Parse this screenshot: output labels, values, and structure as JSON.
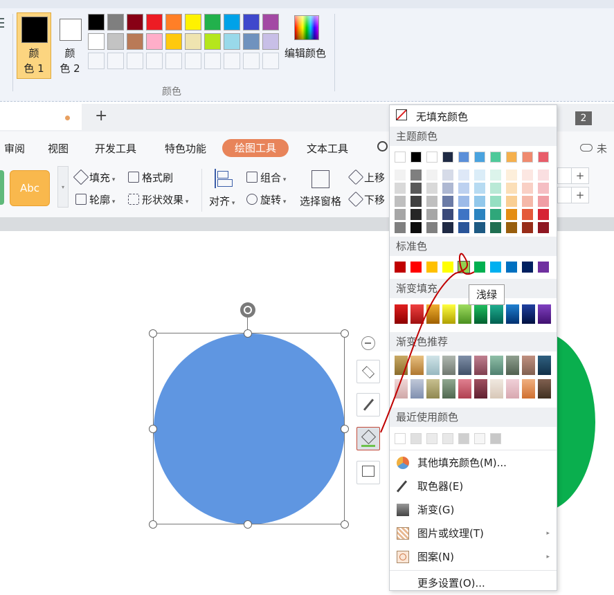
{
  "paint": {
    "color1_label": "颜\n色 1",
    "color2_label": "颜\n色 2",
    "edit_colors_label": "编辑颜色",
    "group_label": "颜色",
    "palette_row1": [
      "#000000",
      "#7f7f7f",
      "#880015",
      "#ed1c24",
      "#ff7f27",
      "#fff200",
      "#22b14c",
      "#00a2e8",
      "#3f48cc",
      "#a349a4"
    ],
    "palette_row2": [
      "#ffffff",
      "#c3c3c3",
      "#b97a57",
      "#ffaec9",
      "#ffc90e",
      "#efe4b0",
      "#b5e61d",
      "#99d9ea",
      "#7092be",
      "#c8bfe7"
    ]
  },
  "tabs": {
    "new_tab_symbol": "+",
    "items": [
      "审阅",
      "视图",
      "开发工具",
      "特色功能",
      "绘图工具",
      "文本工具"
    ],
    "search_icon": "search-icon",
    "right_badge": "2",
    "cloud_label": "未"
  },
  "ribbon": {
    "style_preview": "Abc",
    "fill": "填充",
    "format_painter": "格式刷",
    "outline": "轮廓",
    "shape_effects": "形状效果",
    "align": "对齐",
    "group": "组合",
    "rotate": "旋转",
    "selection_pane": "选择窗格",
    "bring_forward": "上移",
    "send_backward": "下移",
    "spin_plus": "+"
  },
  "menu": {
    "no_fill": "无填充颜色",
    "theme_colors": "主题颜色",
    "standard_colors": "标准色",
    "gradient_fill": "渐变填充",
    "gradient_recommend": "渐变色推荐",
    "recent_colors": "最近使用颜色",
    "more_fill_colors": "其他填充颜色(M)...",
    "eyedropper": "取色器(E)",
    "gradient": "渐变(G)",
    "picture_texture": "图片或纹理(T)",
    "pattern": "图案(N)",
    "more_settings": "更多设置(O)...",
    "tooltip": "浅绿",
    "theme_top": [
      "#ffffff",
      "#000000",
      "#ffffff",
      "#1f2a44",
      "#5b8fd9",
      "#4aa3df",
      "#4fc99a",
      "#f5b04d",
      "#ef8a6f",
      "#e85d6a"
    ],
    "theme_columns": [
      [
        "#f2f2f2",
        "#d9d9d9",
        "#bfbfbf",
        "#a6a6a6",
        "#808080"
      ],
      [
        "#7f7f7f",
        "#595959",
        "#404040",
        "#262626",
        "#0d0d0d"
      ],
      [
        "#f2f2f2",
        "#d9d9d9",
        "#bfbfbf",
        "#a6a6a6",
        "#808080"
      ],
      [
        "#d6dbe8",
        "#aeb8d2",
        "#6b7ba6",
        "#3a4a7a",
        "#1f2a44"
      ],
      [
        "#dee8f7",
        "#bdd1f0",
        "#9cbae8",
        "#3f74c4",
        "#2a5599"
      ],
      [
        "#dbedf8",
        "#b7dbf2",
        "#92c8eb",
        "#2b84c0",
        "#1d5a83"
      ],
      [
        "#dcf4eb",
        "#b9e9d6",
        "#95dfc2",
        "#2fa77a",
        "#1f6f51"
      ],
      [
        "#fdefdb",
        "#fbdfb8",
        "#f9cf94",
        "#e48d14",
        "#985e0d"
      ],
      [
        "#fce7e2",
        "#f9d0c5",
        "#f5b8a9",
        "#e4593a",
        "#982d19"
      ],
      [
        "#fadfe1",
        "#f5bec3",
        "#f09ea5",
        "#d62334",
        "#8f1722"
      ]
    ],
    "standard": [
      "#c00000",
      "#ff0000",
      "#ffc000",
      "#ffff00",
      "#92d050",
      "#00b050",
      "#00b0f0",
      "#0070c0",
      "#002060",
      "#7030a0"
    ],
    "gradient_fill_colors": [
      [
        "#e02020",
        "#8c0000"
      ],
      [
        "#f04040",
        "#a01010"
      ],
      [
        "#f0b030",
        "#a06000"
      ],
      [
        "#ffff40",
        "#b0a000"
      ],
      [
        "#a0dd60",
        "#4a9020"
      ],
      [
        "#20c060",
        "#006030"
      ],
      [
        "#20b090",
        "#006050"
      ],
      [
        "#2080d0",
        "#003070"
      ],
      [
        "#2040a0",
        "#001040"
      ],
      [
        "#8040c0",
        "#401070"
      ]
    ],
    "gradient_rec_row1": [
      [
        "#c9a964",
        "#8b6d2c"
      ],
      [
        "#e8c080",
        "#b07830"
      ],
      [
        "#d0e4e8",
        "#98b8c0"
      ],
      [
        "#b0b8b0",
        "#707870"
      ],
      [
        "#8090a8",
        "#405068"
      ],
      [
        "#c08090",
        "#804050"
      ],
      [
        "#90c0a8",
        "#508070"
      ],
      [
        "#90a090",
        "#506050"
      ],
      [
        "#c09080",
        "#806050"
      ],
      [
        "#306080",
        "#103048"
      ]
    ],
    "gradient_rec_row2": [
      [
        "#f0d8d8",
        "#d0a8a8"
      ],
      [
        "#c0c8d8",
        "#8090b0"
      ],
      [
        "#c8c090",
        "#908850"
      ],
      [
        "#90a890",
        "#506850"
      ],
      [
        "#e08090",
        "#b04050"
      ],
      [
        "#a05060",
        "#602030"
      ],
      [
        "#f0e8e0",
        "#d8c8b8"
      ],
      [
        "#f0d0d8",
        "#d8a8b0"
      ],
      [
        "#f0b080",
        "#d07030"
      ],
      [
        "#806050",
        "#403020"
      ]
    ],
    "recent": [
      "#ffffff",
      "#e0e0e0",
      "#ebebeb",
      "#e8e8e8",
      "#cfcfcf",
      "#f6f6f6",
      "#c8c8c8"
    ]
  }
}
